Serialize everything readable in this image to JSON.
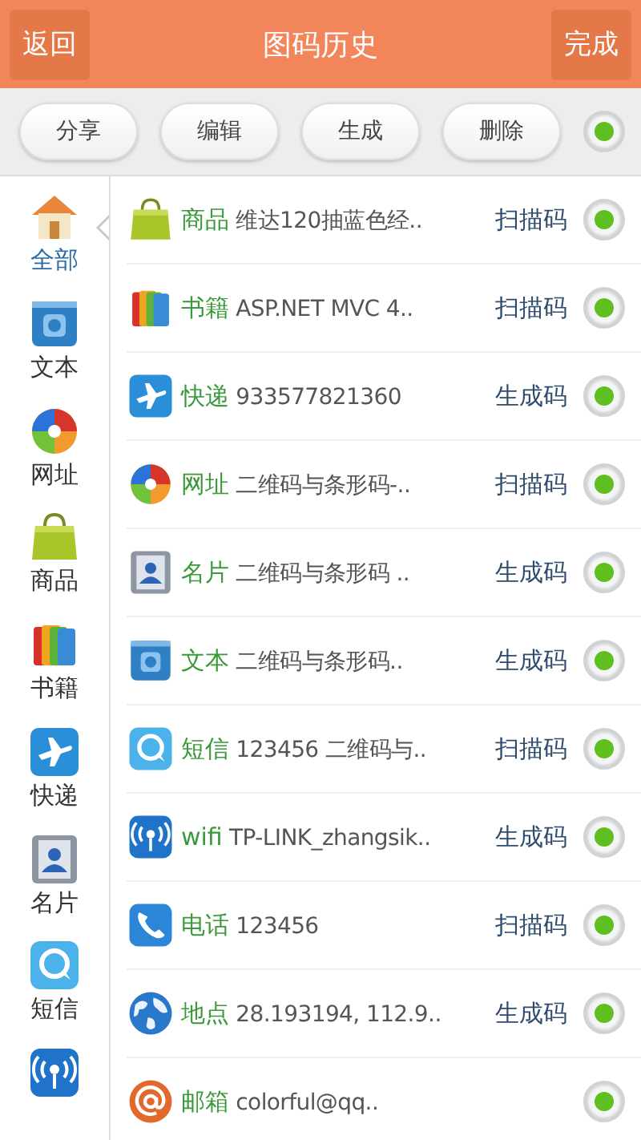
{
  "header": {
    "back": "返回",
    "title": "图码历史",
    "done": "完成"
  },
  "toolbar": {
    "buttons": [
      "分享",
      "编辑",
      "生成",
      "删除"
    ],
    "select_all": {
      "checked": true
    }
  },
  "sidebar": {
    "items": [
      {
        "kind": "home",
        "label": "全部",
        "selected": true
      },
      {
        "kind": "text",
        "label": "文本",
        "selected": false
      },
      {
        "kind": "url",
        "label": "网址",
        "selected": false
      },
      {
        "kind": "goods",
        "label": "商品",
        "selected": false
      },
      {
        "kind": "book",
        "label": "书籍",
        "selected": false
      },
      {
        "kind": "express",
        "label": "快递",
        "selected": false
      },
      {
        "kind": "card",
        "label": "名片",
        "selected": false
      },
      {
        "kind": "sms",
        "label": "短信",
        "selected": false
      },
      {
        "kind": "wifi",
        "selected": false
      }
    ]
  },
  "rows": [
    {
      "kind": "goods",
      "category": "商品",
      "content": "维达120抽蓝色经..",
      "type": "扫描码",
      "checked": true
    },
    {
      "kind": "book",
      "category": "书籍",
      "content": "ASP.NET MVC 4..",
      "type": "扫描码",
      "checked": true
    },
    {
      "kind": "express",
      "category": "快递",
      "content": "933577821360",
      "type": "生成码",
      "checked": true
    },
    {
      "kind": "url",
      "category": "网址",
      "content": "二维码与条形码-..",
      "type": "扫描码",
      "checked": true
    },
    {
      "kind": "card",
      "category": "名片",
      "content": "二维码与条形码 ..",
      "type": "生成码",
      "checked": true
    },
    {
      "kind": "text",
      "category": "文本",
      "content": "二维码与条形码..",
      "type": "生成码",
      "checked": true
    },
    {
      "kind": "sms",
      "category": "短信",
      "content": "123456 二维码与..",
      "type": "扫描码",
      "checked": true
    },
    {
      "kind": "wifi",
      "category": "wifi",
      "content": "TP-LINK_zhangsik..",
      "type": "生成码",
      "checked": true
    },
    {
      "kind": "phone",
      "category": "电话",
      "content": "123456",
      "type": "扫描码",
      "checked": true
    },
    {
      "kind": "location",
      "category": "地点",
      "content": "28.193194, 112.9..",
      "type": "生成码",
      "checked": true
    },
    {
      "kind": "email",
      "category": "邮箱",
      "content": "colorful@qq..",
      "checked": true
    }
  ]
}
